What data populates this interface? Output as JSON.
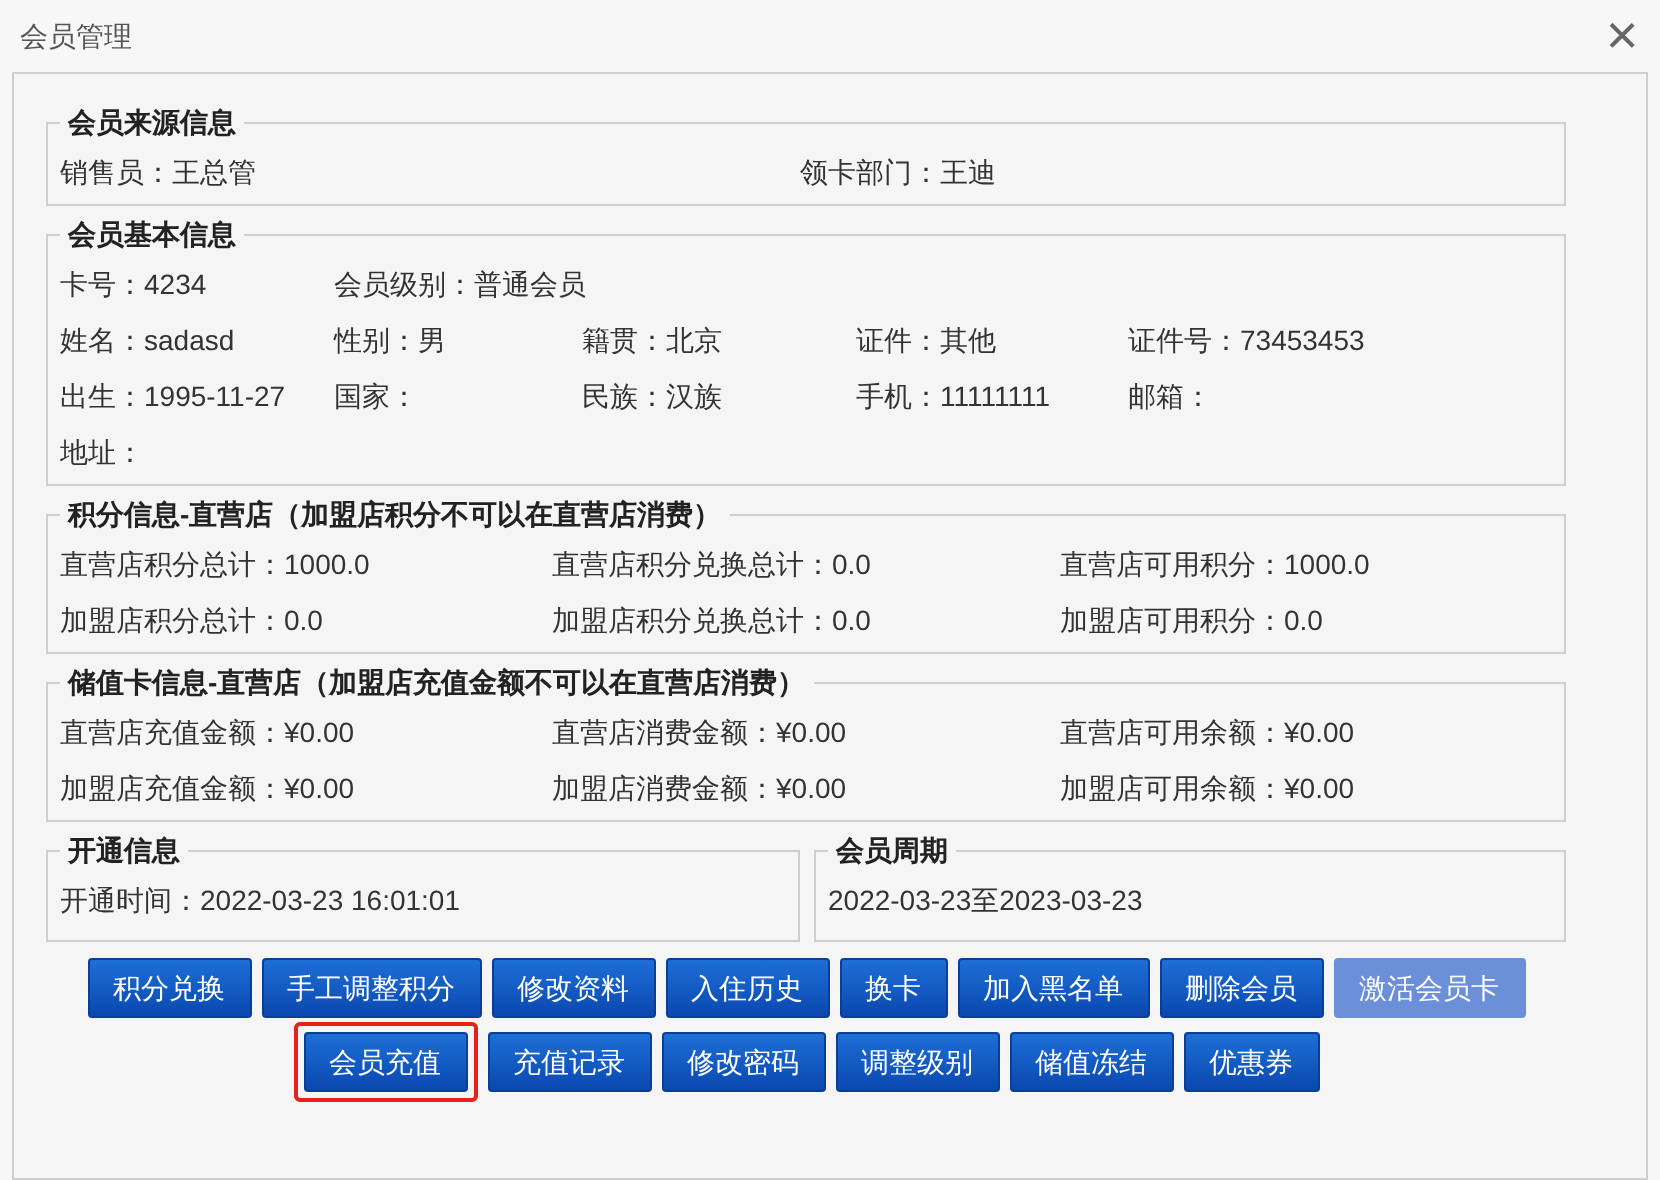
{
  "window": {
    "title": "会员管理",
    "close": "×"
  },
  "sections": [
    {
      "kind": "source",
      "title": "会员来源信息",
      "rows": [
        [
          {
            "label": "销售员：",
            "value": "王总管"
          },
          {
            "label": "领卡部门：",
            "value": "王迪"
          }
        ]
      ]
    },
    {
      "kind": "basic",
      "title": "会员基本信息",
      "rows": [
        [
          {
            "label": "卡号：",
            "value": "4234"
          },
          {
            "label": "会员级别：",
            "value": "普通会员"
          }
        ],
        [
          {
            "label": "姓名：",
            "value": "sadasd"
          },
          {
            "label": "性别：",
            "value": "男"
          },
          {
            "label": "籍贯：",
            "value": "北京"
          },
          {
            "label": "证件：",
            "value": "其他"
          },
          {
            "label": "证件号：",
            "value": "73453453"
          }
        ],
        [
          {
            "label": "出生：",
            "value": "1995-11-27"
          },
          {
            "label": "国家："
          },
          {
            "label": "民族：",
            "value": "汉族"
          },
          {
            "label": "手机：",
            "value": "11111111"
          },
          {
            "label": "邮箱："
          }
        ],
        [
          {
            "label": "地址："
          }
        ]
      ]
    },
    {
      "kind": "balance",
      "title": "积分信息-直营店（加盟店积分不可以在直营店消费）",
      "rows": [
        [
          {
            "label": "直营店积分总计：",
            "value": "1000.0"
          },
          {
            "label": "直营店积分兑换总计：",
            "value": "0.0"
          },
          {
            "label": "直营店可用积分：",
            "value": "1000.0"
          }
        ],
        [
          {
            "label": "加盟店积分总计：",
            "value": "0.0"
          },
          {
            "label": "加盟店积分兑换总计：",
            "value": "0.0"
          },
          {
            "label": "加盟店可用积分：",
            "value": "0.0"
          }
        ]
      ]
    },
    {
      "kind": "balance",
      "title": "储值卡信息-直营店（加盟店充值金额不可以在直营店消费）",
      "rows": [
        [
          {
            "label": "直营店充值金额：",
            "value": "¥0.00"
          },
          {
            "label": "直营店消费金额：",
            "value": "¥0.00"
          },
          {
            "label": "直营店可用余额：",
            "value": "¥0.00"
          }
        ],
        [
          {
            "label": "加盟店充值金额：",
            "value": "¥0.00"
          },
          {
            "label": "加盟店消费金额：",
            "value": "¥0.00"
          },
          {
            "label": "加盟店可用余额：",
            "value": "¥0.00"
          }
        ]
      ]
    }
  ],
  "opening": {
    "title": "开通信息",
    "label": "开通时间：",
    "value": "2022-03-23 16:01:01"
  },
  "period": {
    "title": "会员周期",
    "value": "2022-03-23至2023-03-23"
  },
  "button_rows": [
    [
      {
        "label": "积分兑换",
        "disabled": false,
        "highlighted": false
      },
      {
        "label": "手工调整积分",
        "disabled": false,
        "highlighted": false
      },
      {
        "label": "修改资料",
        "disabled": false,
        "highlighted": false
      },
      {
        "label": "入住历史",
        "disabled": false,
        "highlighted": false
      },
      {
        "label": "换卡",
        "disabled": false,
        "highlighted": false
      },
      {
        "label": "加入黑名单",
        "disabled": false,
        "highlighted": false
      },
      {
        "label": "删除会员",
        "disabled": false,
        "highlighted": false
      },
      {
        "label": "激活会员卡",
        "disabled": true,
        "highlighted": false
      }
    ],
    [
      {
        "label": "会员充值",
        "disabled": false,
        "highlighted": true
      },
      {
        "label": "充值记录",
        "disabled": false,
        "highlighted": false
      },
      {
        "label": "修改密码",
        "disabled": false,
        "highlighted": false
      },
      {
        "label": "调整级别",
        "disabled": false,
        "highlighted": false
      },
      {
        "label": "储值冻结",
        "disabled": false,
        "highlighted": false
      },
      {
        "label": "优惠券",
        "disabled": false,
        "highlighted": false
      }
    ]
  ]
}
